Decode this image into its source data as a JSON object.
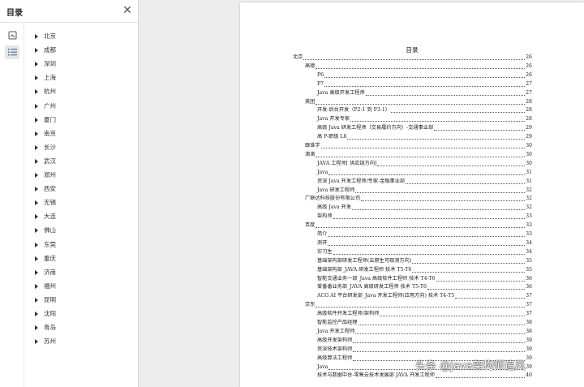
{
  "sidebar": {
    "title": "目录",
    "close_icon": "close-icon",
    "rail": [
      {
        "name": "thumbnail-view-icon"
      },
      {
        "name": "outline-view-icon",
        "active": true
      }
    ],
    "outline": [
      "北京",
      "成都",
      "深圳",
      "上海",
      "杭州",
      "广州",
      "厦门",
      "南京",
      "长沙",
      "武汉",
      "郑州",
      "西安",
      "无锡",
      "大连",
      "佛山",
      "东莞",
      "重庆",
      "济南",
      "福州",
      "昆明",
      "沈阳",
      "青岛",
      "苏州"
    ]
  },
  "document": {
    "title": "目录",
    "toc": [
      {
        "text": "北京",
        "page": "26",
        "level": 0
      },
      {
        "text": "高德",
        "page": "26",
        "level": 1
      },
      {
        "text": "P6",
        "page": "26",
        "level": 2
      },
      {
        "text": "P7",
        "page": "27",
        "level": 2
      },
      {
        "text": "Java 高级开发工程师",
        "page": "27",
        "level": 2
      },
      {
        "text": "美团",
        "page": "28",
        "level": 1
      },
      {
        "text": "开发-后台开发（P2-1 到 P3-1）",
        "page": "28",
        "level": 2
      },
      {
        "text": "Java 开发专家",
        "page": "28",
        "level": 2
      },
      {
        "text": "高级 Java 研发工程师（交易履约方向）-交通事业部",
        "page": "29",
        "level": 2
      },
      {
        "text": "高 P-职级 L8",
        "page": "29",
        "level": 2
      },
      {
        "text": "跟谁学",
        "page": "30",
        "level": 1
      },
      {
        "text": "滴滴",
        "page": "30",
        "level": 1
      },
      {
        "text": "JAVA 工程师[ 供应链方向]",
        "page": "30",
        "level": 2
      },
      {
        "text": "Java",
        "page": "31",
        "level": 2
      },
      {
        "text": "资深 Java 开发工程师/专家-金融事业部",
        "page": "31",
        "level": 2
      },
      {
        "text": "Java 研发工程师",
        "page": "32",
        "level": 2
      },
      {
        "text": "广联达科技股份有限公司",
        "page": "32",
        "level": 1
      },
      {
        "text": "高级 Java 开发",
        "page": "32",
        "level": 2
      },
      {
        "text": "架构师",
        "page": "33",
        "level": 2
      },
      {
        "text": "百度",
        "page": "33",
        "level": 1
      },
      {
        "text": "简介",
        "page": "33",
        "level": 2
      },
      {
        "text": "测开",
        "page": "34",
        "level": 2
      },
      {
        "text": "实习生",
        "page": "34",
        "level": 2
      },
      {
        "text": "基础架构部研发工程师(云原生可观测方向)",
        "page": "35",
        "level": 2
      },
      {
        "text": "基础架构部_JAVA 研发工程师 技术 T5-T6",
        "page": "35",
        "level": 2
      },
      {
        "text": "智能交通业务一部_Java 高级软件工程师 技术 T4-T6",
        "page": "36",
        "level": 2
      },
      {
        "text": "爱番番业务部_JAVA 高级研发工程师 技术 T5-T6",
        "page": "36",
        "level": 2
      },
      {
        "text": "ACG AI 平台研发部_Java 开发工程师(应用方向) 技术 T4-T5",
        "page": "37",
        "level": 2
      },
      {
        "text": "京东",
        "page": "37",
        "level": 1
      },
      {
        "text": "高级软件开发工程师/架构师",
        "page": "37",
        "level": 2
      },
      {
        "text": "智能监控产品经理",
        "page": "38",
        "level": 2
      },
      {
        "text": "Java 开发工程师",
        "page": "38",
        "level": 2
      },
      {
        "text": "高级开发架构师",
        "page": "39",
        "level": 2
      },
      {
        "text": "资深技术架构师",
        "page": "39",
        "level": 2
      },
      {
        "text": "高级算法工程师",
        "page": "39",
        "level": 2
      },
      {
        "text": "Java",
        "page": "39",
        "level": 2
      },
      {
        "text": "技术与数据中台-零售云技术发展部 JAVA 开发工程师",
        "page": "40",
        "level": 2
      }
    ]
  },
  "watermark": "头条 @Java架构师追风"
}
